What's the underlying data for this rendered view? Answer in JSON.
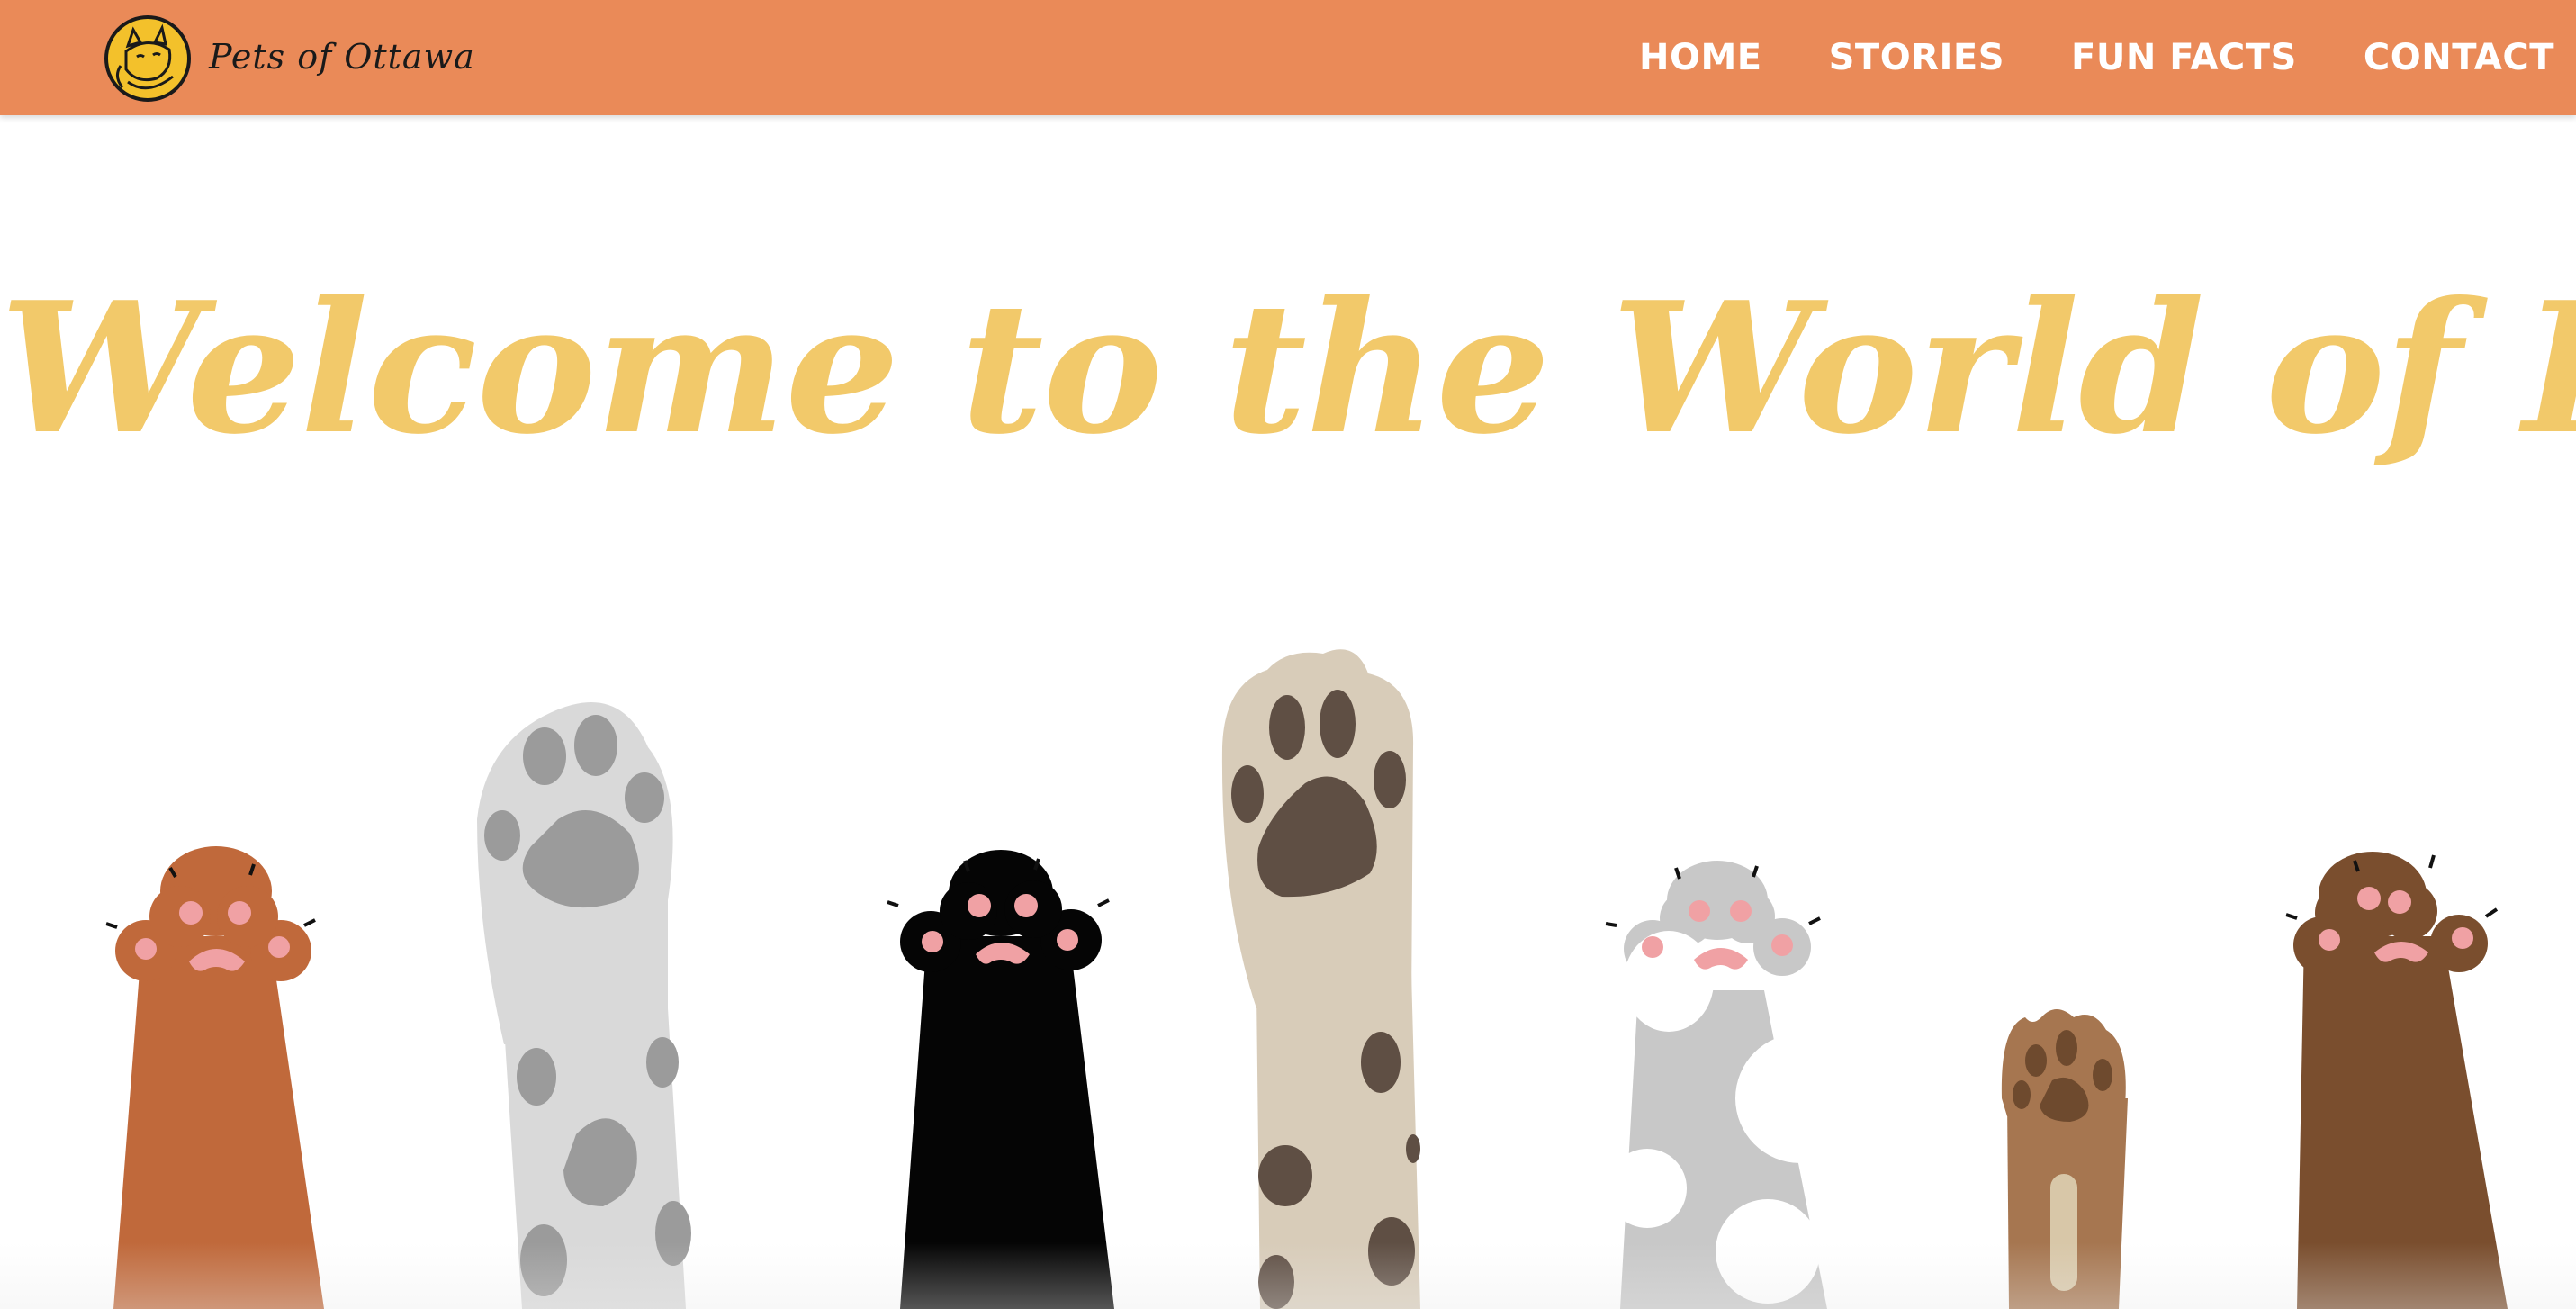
{
  "navbar": {
    "brand_name": "Pets of Ottawa",
    "logo_icon": "cat-logo-icon",
    "background_color": "#ea8a58",
    "links": [
      {
        "label": "HOME"
      },
      {
        "label": "STORIES"
      },
      {
        "label": "FUN FACTS"
      },
      {
        "label": "CONTACT"
      }
    ]
  },
  "hero": {
    "title": "Welcome to the World of Pets!",
    "title_color": "#f2c96a",
    "illustration": "raised-pet-paws-illustration",
    "paw_colors": [
      "#c0693b",
      "#d9d9d9",
      "#000000",
      "#d8ccb9",
      "#c8c8c8",
      "#a67650",
      "#7a4e2e"
    ]
  }
}
